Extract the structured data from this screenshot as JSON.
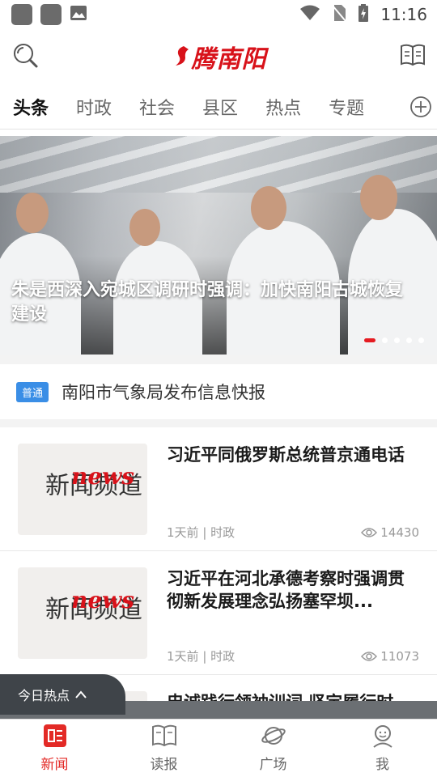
{
  "status_bar": {
    "time": "11:16",
    "icons": [
      "app-notification-icon",
      "app-notification-icon",
      "image-icon",
      "wifi-icon",
      "no-sim-icon",
      "battery-charging-icon"
    ]
  },
  "app_bar": {
    "logo_text": "腾南阳",
    "left_icon": "search-icon",
    "right_icon": "book-icon"
  },
  "tabs": [
    {
      "label": "头条",
      "active": true
    },
    {
      "label": "时政"
    },
    {
      "label": "社会"
    },
    {
      "label": "县区"
    },
    {
      "label": "热点"
    },
    {
      "label": "专题"
    }
  ],
  "hero": {
    "title": "朱是西深入宛城区调研时强调：加快南阳古城恢复建设",
    "slide_count": 5,
    "active_slide": 1
  },
  "notice": {
    "badge": "普通",
    "text": "南阳市气象局发布信息快报"
  },
  "news": [
    {
      "title": "习近平同俄罗斯总统普京通电话",
      "time": "1天前",
      "category": "时政",
      "views": "14430",
      "thumb_text_cn": "新闻频道",
      "thumb_text_en": "news"
    },
    {
      "title": "习近平在河北承德考察时强调贯彻新发展理念弘扬塞罕坝...",
      "time": "1天前",
      "category": "时政",
      "views": "11073",
      "thumb_text_cn": "新闻频道",
      "thumb_text_en": "news"
    },
    {
      "title": "忠诚践行领袖训词 坚定履行时",
      "time": "",
      "category": "",
      "views": ""
    }
  ],
  "hot_pill": {
    "label": "今日热点"
  },
  "bottom_nav": [
    {
      "label": "新闻",
      "icon": "news-icon",
      "active": true
    },
    {
      "label": "读报",
      "icon": "newspaper-icon"
    },
    {
      "label": "广场",
      "icon": "planet-icon"
    },
    {
      "label": "我",
      "icon": "profile-icon"
    }
  ],
  "colors": {
    "accent": "#e32a26",
    "badge": "#3a8ee6"
  }
}
